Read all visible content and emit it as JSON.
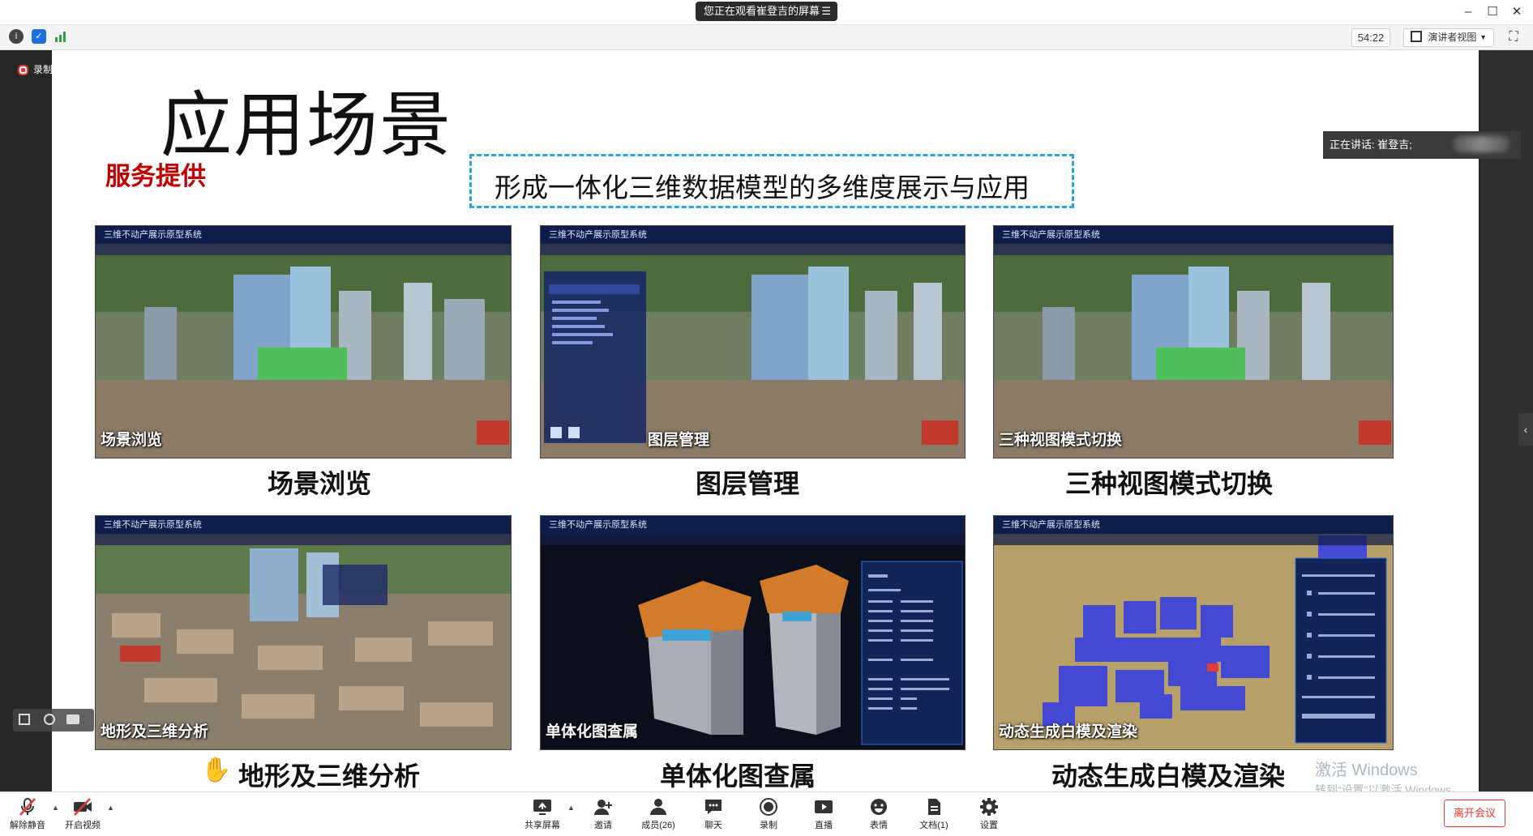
{
  "window": {
    "share_banner": "您正在观看崔登吉的屏幕",
    "menu_glyph": "☰"
  },
  "infobar": {
    "timer": "54:22",
    "view_mode": "演讲者视图"
  },
  "recording": {
    "label": "录制中"
  },
  "speaking": {
    "label": "正在讲话: 崔登吉;"
  },
  "slide": {
    "title": "应用场景",
    "subtitle": "服务提供",
    "banner": "形成一体化三维数据模型的多维度展示与应用",
    "app_header": "三维不动产展示原型系统",
    "cards": [
      {
        "label": "场景浏览",
        "caption": "场景浏览",
        "style": "city"
      },
      {
        "label": "图层管理",
        "caption": "图层管理",
        "style": "city-layers"
      },
      {
        "label": "三种视图模式切换",
        "caption": "三种视图模式切换",
        "style": "city"
      },
      {
        "label": "地形及三维分析",
        "caption": "地形及三维分析",
        "style": "city-dense"
      },
      {
        "label": "单体化图查属",
        "caption": "单体化图查属",
        "style": "tower"
      },
      {
        "label": "动态生成白模及渲染",
        "caption": "动态生成白模及渲染",
        "style": "blocks"
      }
    ]
  },
  "activation": {
    "line1": "激活 Windows",
    "line2": "转到“设置”以激活 Windows。"
  },
  "toolbar": {
    "unmute": "解除静音",
    "start_video": "开启视频",
    "share_screen": "共享屏幕",
    "invite": "邀请",
    "members": "成员(26)",
    "chat": "聊天",
    "record": "录制",
    "live": "直播",
    "reactions": "表情",
    "docs": "文档(1)",
    "settings": "设置",
    "leave": "离开会议"
  },
  "colors": {
    "accent_red": "#e53935",
    "banner_border": "#2aa6d6",
    "subtitle_red": "#c00000"
  }
}
